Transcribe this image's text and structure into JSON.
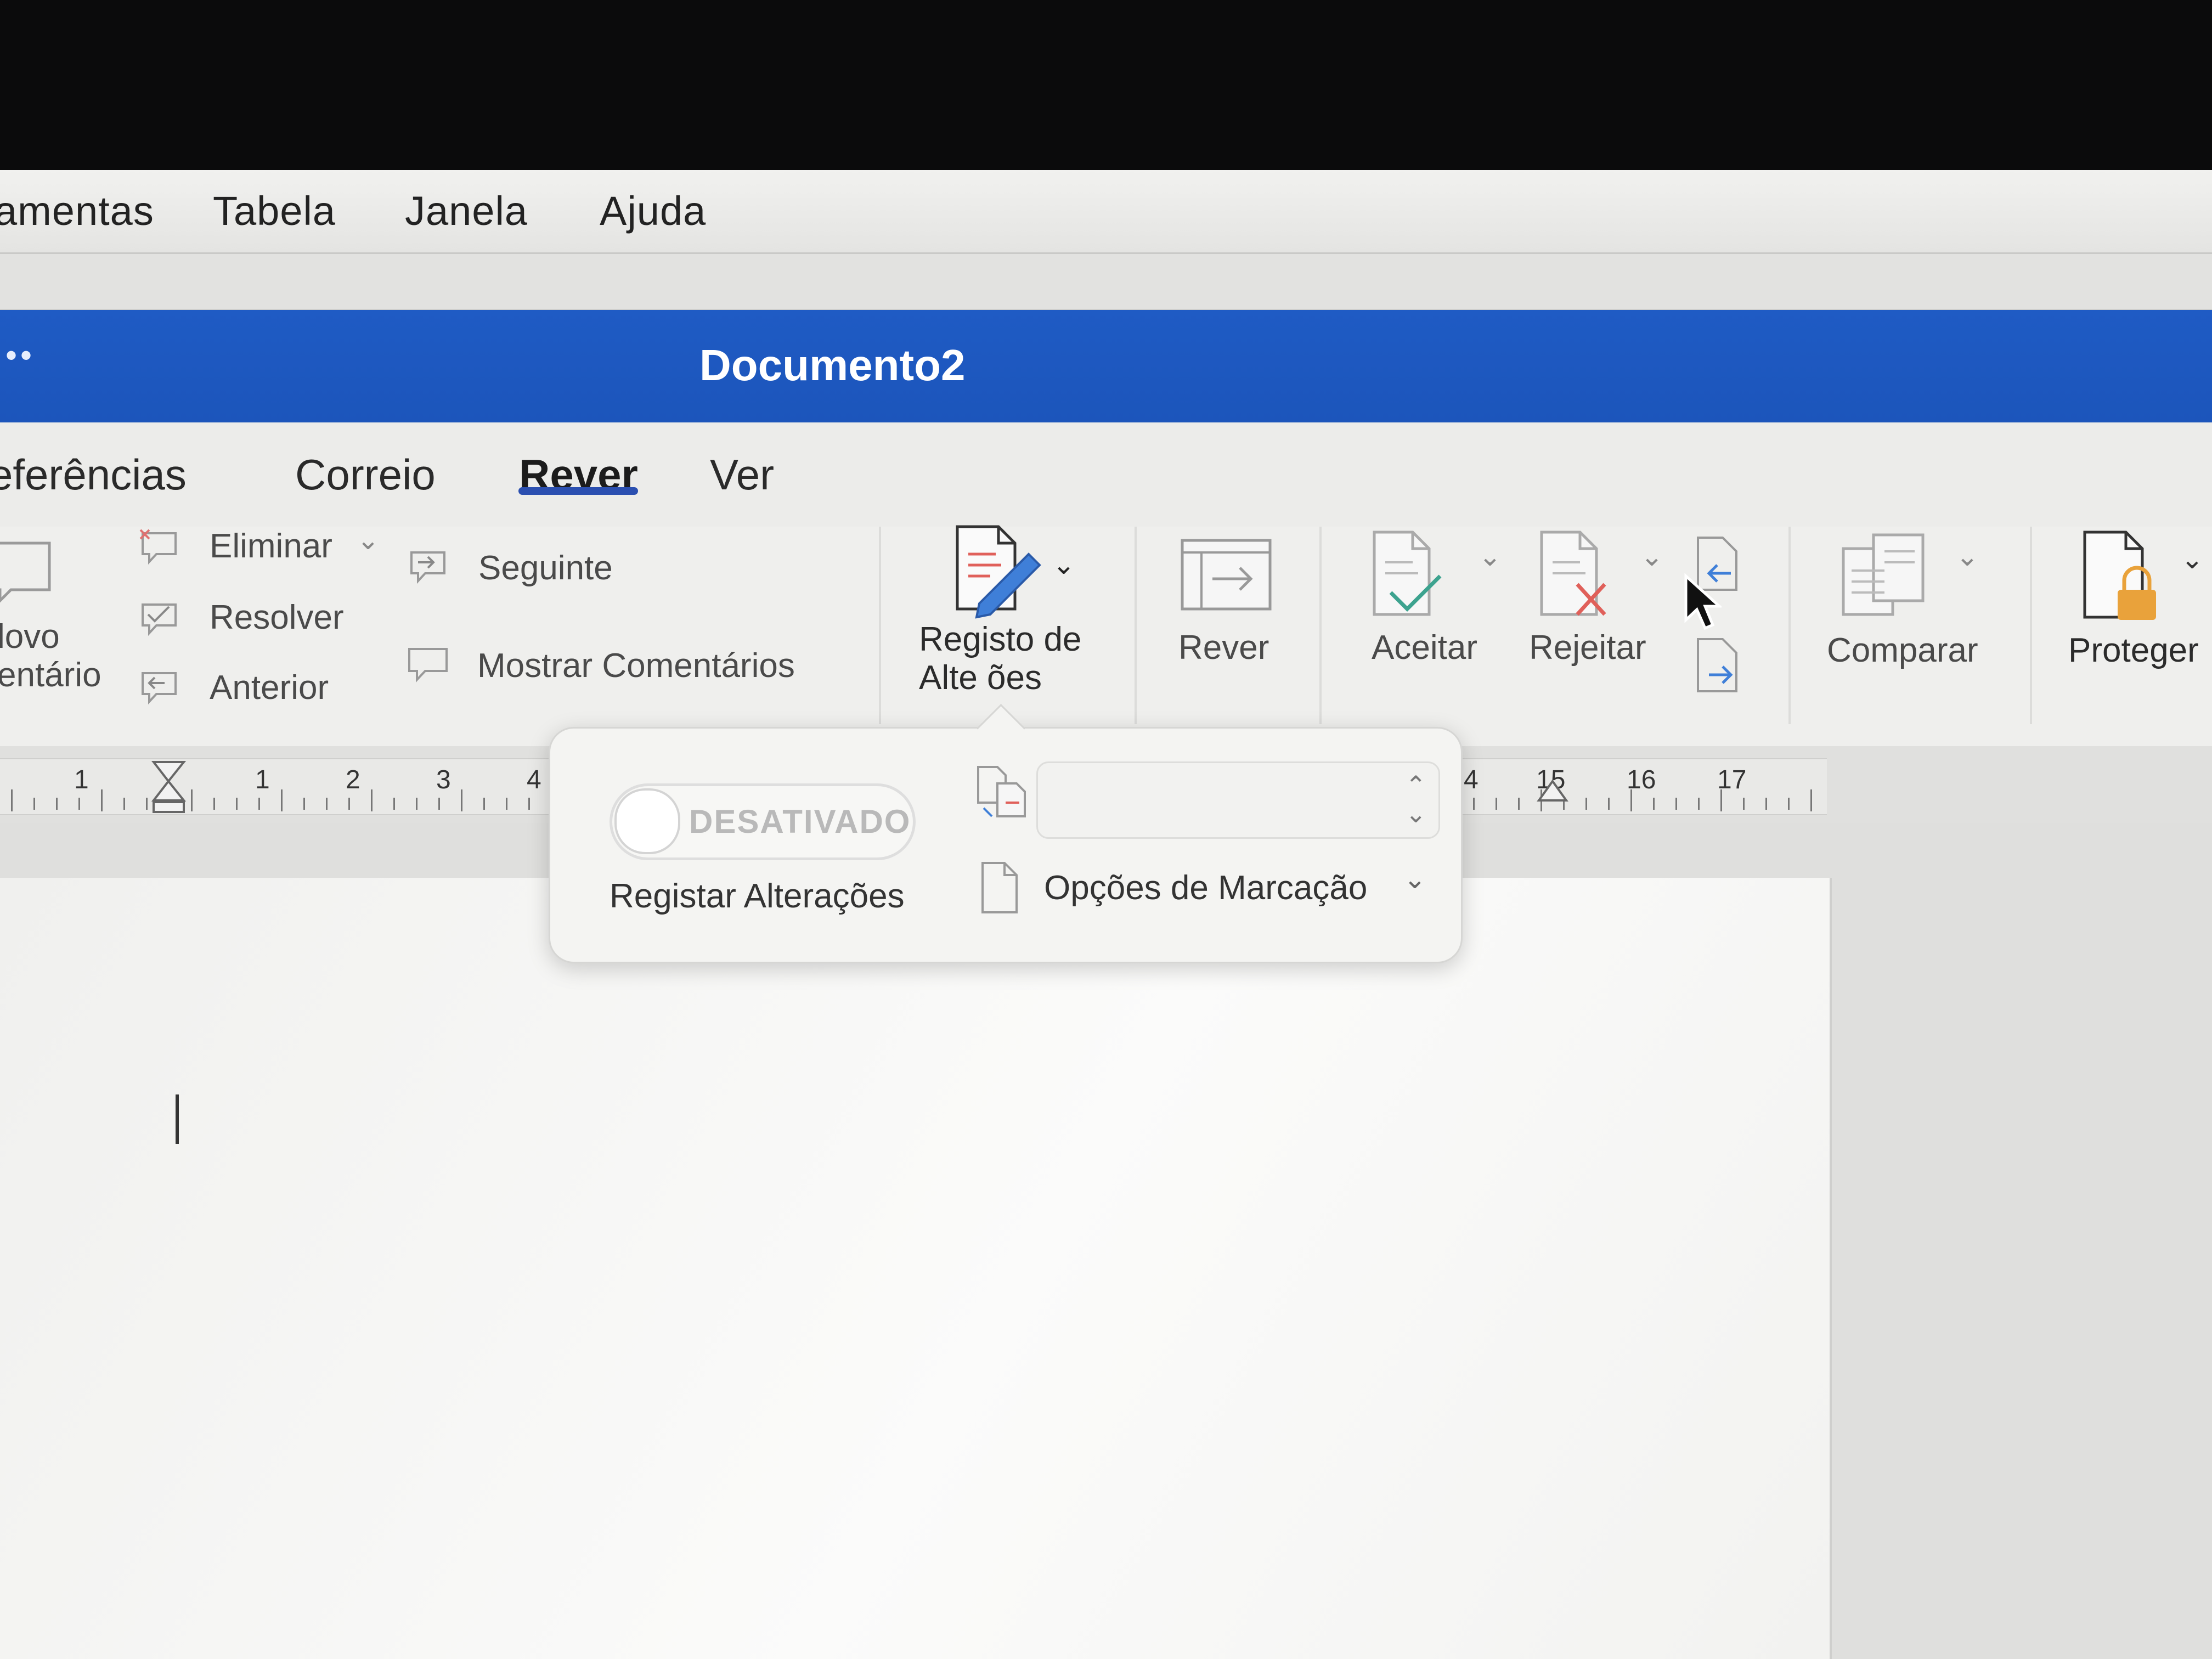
{
  "menubar": {
    "items": [
      "amentas",
      "Tabela",
      "Janela",
      "Ajuda"
    ]
  },
  "window": {
    "dots": "••",
    "title": "Documento2"
  },
  "tabs": [
    {
      "label": "eferências"
    },
    {
      "label": "Correio"
    },
    {
      "label": "Rever"
    },
    {
      "label": "Ver"
    }
  ],
  "ribbon": {
    "new_comment_line1": "lovo",
    "new_comment_line2": "entário",
    "eliminar": "Eliminar",
    "resolver": "Resolver",
    "anterior": "Anterior",
    "seguinte": "Seguinte",
    "mostrar_comentarios": "Mostrar Comentários",
    "registo_line1": "Registo de",
    "registo_line2": "Alte   ões",
    "rever": "Rever",
    "aceitar": "Aceitar",
    "rejeitar": "Rejeitar",
    "comparar": "Comparar",
    "proteger": "Proteger"
  },
  "ruler": {
    "left_numbers": [
      "1",
      "1",
      "2",
      "3",
      "4"
    ],
    "right_numbers": [
      "4",
      "15",
      "16",
      "17"
    ]
  },
  "popover": {
    "toggle_state": "DESATIVADO",
    "toggle_caption": "Registar Alterações",
    "combo_value": "",
    "markup_options": "Opções de Marcação"
  },
  "colors": {
    "titlebar": "#1f5bc4",
    "tab_underline": "#2b4fb0",
    "pen_blue": "#3f7fd8",
    "accept_green": "#3da38f",
    "reject_red": "#e0605a",
    "lock_orange": "#e9a23b"
  }
}
